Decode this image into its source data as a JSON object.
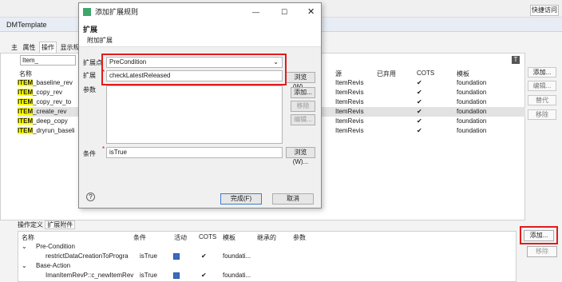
{
  "topbar": {
    "quick_access": "快捷访问"
  },
  "editor_tabs": [
    "DMTemplate"
  ],
  "prop_tabs": [
    "主",
    "属性",
    "操作",
    "显示规则"
  ],
  "main": {
    "filter_value": "Item_",
    "headers": {
      "name": "名称",
      "source": "源",
      "deprecated": "已弃用",
      "cots": "COTS",
      "template": "模板"
    },
    "rows": [
      {
        "prefix": "ITEM",
        "suffix": "_baseline_rev",
        "source": "ItemRevis",
        "cots": "✔",
        "template": "foundation"
      },
      {
        "prefix": "ITEM",
        "suffix": "_copy_rev",
        "source": "ItemRevis",
        "cots": "✔",
        "template": "foundation"
      },
      {
        "prefix": "ITEM",
        "suffix": "_copy_rev_to",
        "source": "ItemRevis",
        "cots": "✔",
        "template": "foundation"
      },
      {
        "prefix": "ITEM",
        "suffix": "_create_rev",
        "source": "ItemRevis",
        "cots": "✔",
        "template": "foundation"
      },
      {
        "prefix": "ITEM",
        "suffix": "_deep_copy",
        "source": "ItemRevis",
        "cots": "✔",
        "template": "foundation"
      },
      {
        "prefix": "ITEM",
        "suffix": "_dryrun_baseli",
        "source": "ItemRevis",
        "cots": "✔",
        "template": "foundation"
      }
    ],
    "side_buttons": [
      "添加...",
      "编辑...",
      "替代",
      "移除"
    ]
  },
  "bottom": {
    "tabs": [
      "操作定义",
      "扩展附件"
    ],
    "headers": {
      "name": "名称",
      "condition": "条件",
      "active": "活动",
      "cots": "COTS",
      "template": "模板",
      "inherited": "继承的",
      "params": "参数"
    },
    "rows": [
      {
        "name": "Pre-Condition",
        "condition": "",
        "template": "",
        "group": true
      },
      {
        "name": "restrictDataCreationToProgra",
        "condition": "isTrue",
        "template": "foundati...",
        "group": false
      },
      {
        "name": "Base-Action",
        "condition": "",
        "template": "",
        "group": true
      },
      {
        "name": "ImanItemRevP::c_newItemRev",
        "condition": "isTrue",
        "template": "foundati...",
        "group": false
      }
    ],
    "add_button": "添加...",
    "remove_button": "移除"
  },
  "dialog": {
    "title": "添加扩展规则",
    "header_title": "扩展",
    "header_subtitle": "附加扩展",
    "extension_point_label": "扩展点",
    "extension_point_value": "PreCondition",
    "extension_label": "扩展",
    "extension_value": "checkLatestReleased",
    "params_label": "参数",
    "condition_label": "条件",
    "condition_value": "isTrue",
    "browse": "浏览(W)...",
    "param_add": "添加...",
    "param_remove": "移除",
    "param_edit": "编辑...",
    "finish": "完成(F)",
    "cancel": "取消",
    "help": "?"
  }
}
